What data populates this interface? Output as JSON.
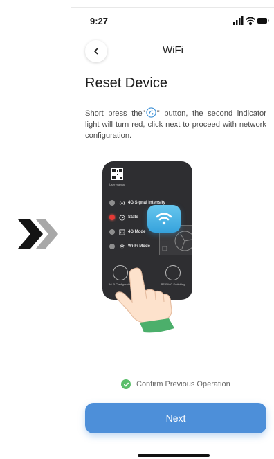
{
  "status_bar": {
    "time": "9:27"
  },
  "nav": {
    "title": "WiFi"
  },
  "page": {
    "heading": "Reset Device",
    "instruction_before": "Short press the\"",
    "instruction_after": "\" button, the second indicator light will turn red, click next to proceed with network configuration."
  },
  "device": {
    "manual_label": "User manual",
    "indicators": [
      {
        "label": "4G Signal Intensity",
        "state": "off"
      },
      {
        "label": "State",
        "state": "red"
      },
      {
        "label": "4G Mode",
        "state": "off"
      },
      {
        "label": "Wi-Fi Mode",
        "state": "off"
      }
    ],
    "buttons": [
      {
        "label": "Wi-Fi Configuration"
      },
      {
        "label": "RF-FI/4G Switching"
      }
    ]
  },
  "confirm": {
    "label": "Confirm Previous Operation",
    "checked": true
  },
  "actions": {
    "next_label": "Next"
  },
  "colors": {
    "primary": "#4d8fd9",
    "success": "#5bbf6b",
    "indicator_red": "#e53935",
    "device_body": "#2e2e31"
  },
  "icons": [
    "double-chevron-right-icon",
    "back-chevron-icon",
    "signal-icon",
    "wifi-icon",
    "battery-icon",
    "reset-button-icon",
    "qr-code-icon",
    "wifi-badge-icon",
    "pointing-hand-icon",
    "check-icon"
  ]
}
